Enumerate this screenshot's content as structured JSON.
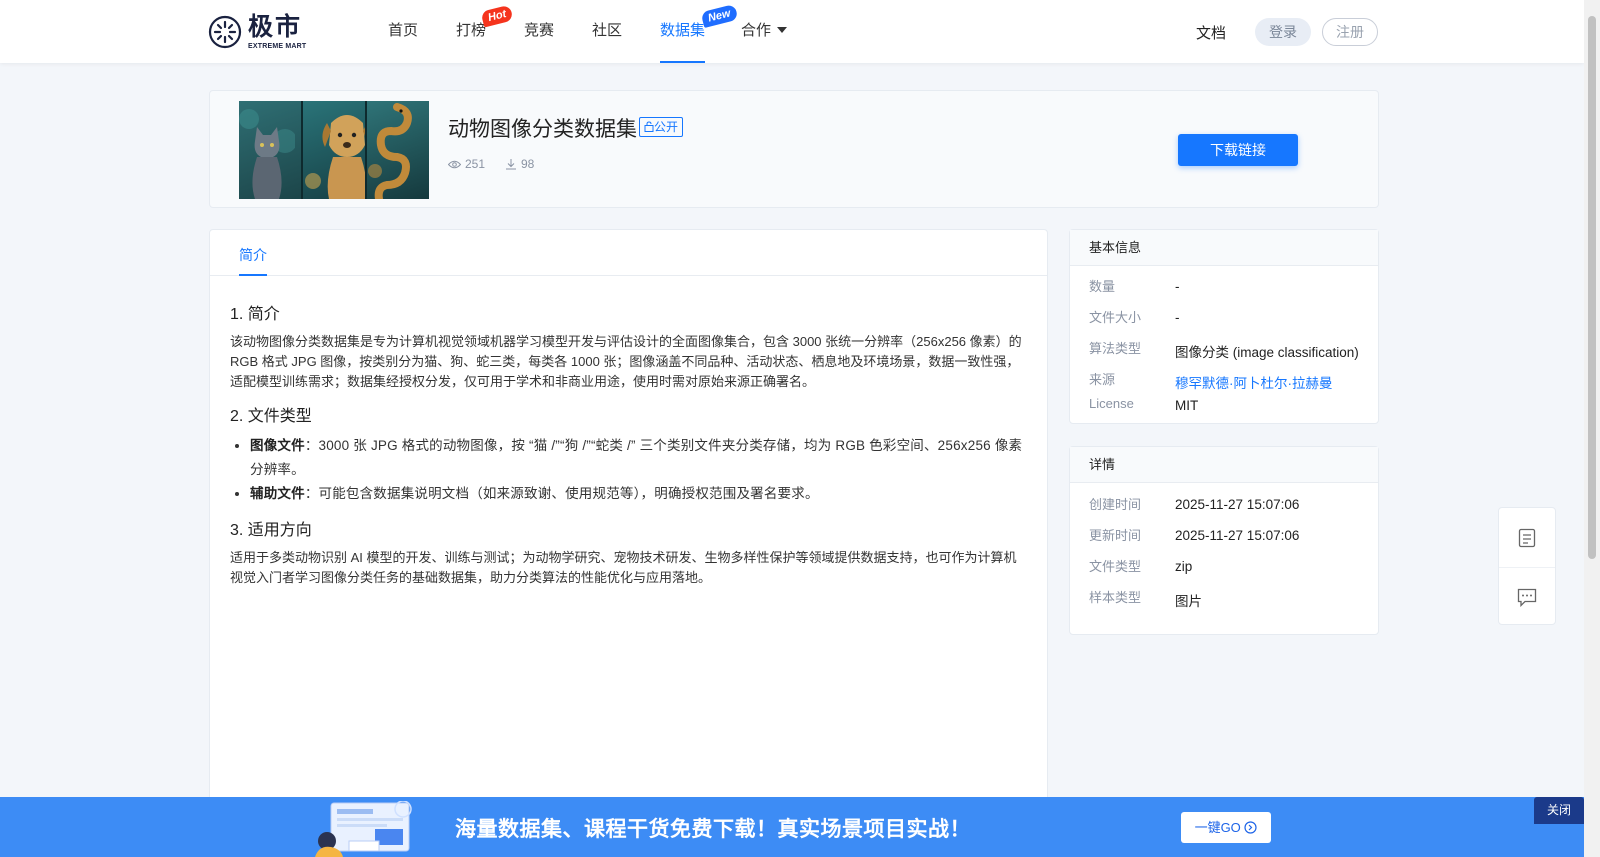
{
  "header": {
    "logo_main": "极市",
    "logo_sub": "EXTREME MART",
    "nav": [
      {
        "label": "首页"
      },
      {
        "label": "打榜",
        "badge": "Hot"
      },
      {
        "label": "竞赛"
      },
      {
        "label": "社区"
      },
      {
        "label": "数据集",
        "badge": "New",
        "active": true
      },
      {
        "label": "合作"
      }
    ],
    "docs": "文档",
    "login": "登录",
    "register": "注册"
  },
  "dataset": {
    "title": "动物图像分类数据集",
    "visibility": "公开",
    "views": "251",
    "downloads": "98",
    "download_button": "下载链接"
  },
  "main": {
    "tab": "简介",
    "sections": {
      "intro_heading": "1. 简介",
      "intro_text": "该动物图像分类数据集是专为计算机视觉领域机器学习模型开发与评估设计的全面图像集合，包含 3000 张统一分辨率（256x256 像素）的 RGB 格式 JPG 图像，按类别分为猫、狗、蛇三类，每类各 1000 张；图像涵盖不同品种、活动状态、栖息地及环境场景，数据一致性强，适配模型训练需求；数据集经授权分发，仅可用于学术和非商业用途，使用时需对原始来源正确署名。",
      "filetype_heading": "2. 文件类型",
      "filetype_items": [
        {
          "label": "图像文件",
          "text": "：3000 张 JPG 格式的动物图像，按 “猫 /”“狗 /”“蛇类 /” 三个类别文件夹分类存储，均为 RGB 色彩空间、256x256 像素分辨率。"
        },
        {
          "label": "辅助文件",
          "text": "：可能包含数据集说明文档（如来源致谢、使用规范等），明确授权范围及署名要求。"
        }
      ],
      "usage_heading": "3. 适用方向",
      "usage_text": "适用于多类动物识别 AI 模型的开发、训练与测试；为动物学研究、宠物技术研发、生物多样性保护等领域提供数据支持，也可作为计算机视觉入门者学习图像分类任务的基础数据集，助力分类算法的性能优化与应用落地。"
    }
  },
  "basic_info": {
    "title": "基本信息",
    "rows": [
      {
        "key": "数量",
        "value": "-"
      },
      {
        "key": "文件大小",
        "value": "-"
      },
      {
        "key": "算法类型",
        "value": "图像分类 (image classification)"
      },
      {
        "key": "来源",
        "value": "穆罕默德·阿卜杜尔·拉赫曼"
      },
      {
        "key": "License",
        "value": "MIT"
      }
    ]
  },
  "details": {
    "title": "详情",
    "rows": [
      {
        "key": "创建时间",
        "value": "2025-11-27 15:07:06"
      },
      {
        "key": "更新时间",
        "value": "2025-11-27 15:07:06"
      },
      {
        "key": "文件类型",
        "value": "zip"
      },
      {
        "key": "样本类型",
        "value": "图片"
      }
    ]
  },
  "banner": {
    "text": "海量数据集、课程干货免费下载！真实场景项目实战！",
    "button": "一键GO",
    "close": "关闭"
  },
  "colors": {
    "accent": "#1677ff",
    "banner": "#3d8cf5",
    "hot_badge": "#f5341d",
    "new_badge": "#1f6dff"
  },
  "icons": [
    "eye-icon",
    "download-icon",
    "chevron-down-icon",
    "document-icon",
    "chat-icon",
    "arrow-circle-icon",
    "lock-icon"
  ]
}
